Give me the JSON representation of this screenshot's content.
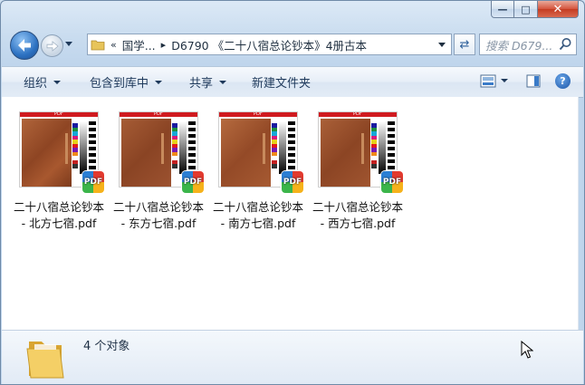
{
  "window": {
    "caption": {
      "minimize_glyph": "—",
      "maximize_glyph": "□",
      "close_glyph": "✕"
    }
  },
  "nav": {
    "address": {
      "overflow_chevron": "«",
      "segments": [
        "国学...",
        "D6790 《二十八宿总论钞本》4册古本"
      ],
      "separator_glyph": "▸"
    },
    "refresh_glyph": "⇄",
    "search": {
      "placeholder": "搜索 D679..."
    }
  },
  "toolbar": {
    "organize": "组织",
    "include_in_library": "包含到库中",
    "share": "共享",
    "new_folder": "新建文件夹",
    "help_glyph": "?"
  },
  "files": [
    {
      "line1": "二十八宿总论钞本",
      "line2": "- 北方七宿.pdf"
    },
    {
      "line1": "二十八宿总论钞本",
      "line2": "- 东方七宿.pdf"
    },
    {
      "line1": "二十八宿总论钞本",
      "line2": "- 南方七宿.pdf"
    },
    {
      "line1": "二十八宿总论钞本",
      "line2": "- 西方七宿.pdf"
    }
  ],
  "thumbnail": {
    "page_header": "PDF",
    "badge": "PDF"
  },
  "details": {
    "count_text": "4 个对象"
  },
  "colors": {
    "accent": "#1e395b",
    "pdf_red": "#d01b20",
    "selection": "#cfe0f1"
  }
}
